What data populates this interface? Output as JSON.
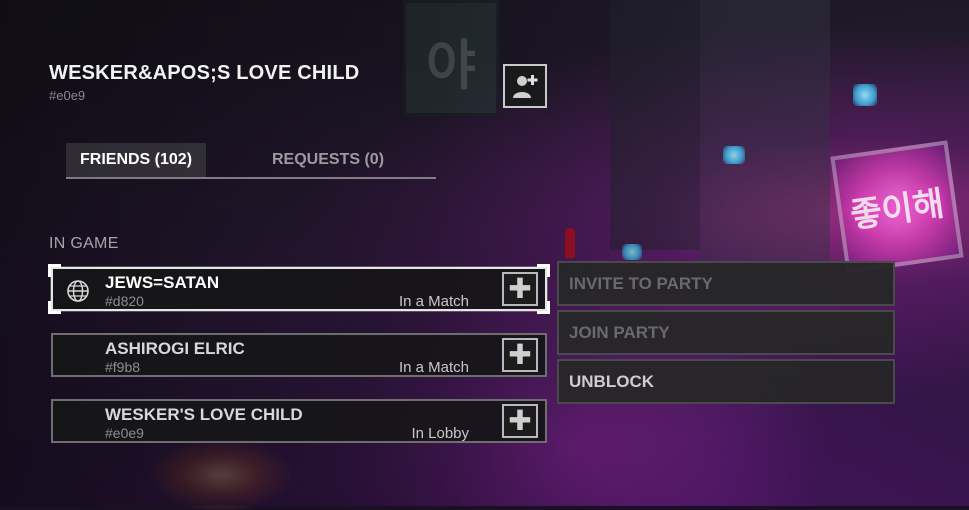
{
  "profile": {
    "name": "WESKER&APOS;S LOVE CHILD",
    "tag": "#e0e9",
    "add_friend_icon": "add-user-icon"
  },
  "tabs": [
    {
      "label": "FRIENDS (102)",
      "active": true
    },
    {
      "label": "REQUESTS (0)",
      "active": false
    }
  ],
  "section_label": "IN GAME",
  "friends": [
    {
      "name": "JEWS=SATAN",
      "tag": "#d820",
      "status": "In a Match",
      "platform_icon": "globe-icon",
      "selected": true
    },
    {
      "name": "ASHIROGI ELRIC",
      "tag": "#f9b8",
      "status": "In a Match",
      "platform_icon": "",
      "selected": false
    },
    {
      "name": "WESKER'S LOVE CHILD",
      "tag": "#e0e9",
      "status": "In Lobby",
      "platform_icon": "",
      "selected": false
    }
  ],
  "context_menu": [
    {
      "label": "INVITE TO PARTY",
      "enabled": false
    },
    {
      "label": "JOIN PARTY",
      "enabled": false
    },
    {
      "label": "UNBLOCK",
      "enabled": true
    }
  ],
  "colors": {
    "accent_neon": "#ff40d0",
    "text_primary": "#f2f2f2",
    "text_muted": "#8a8790"
  }
}
